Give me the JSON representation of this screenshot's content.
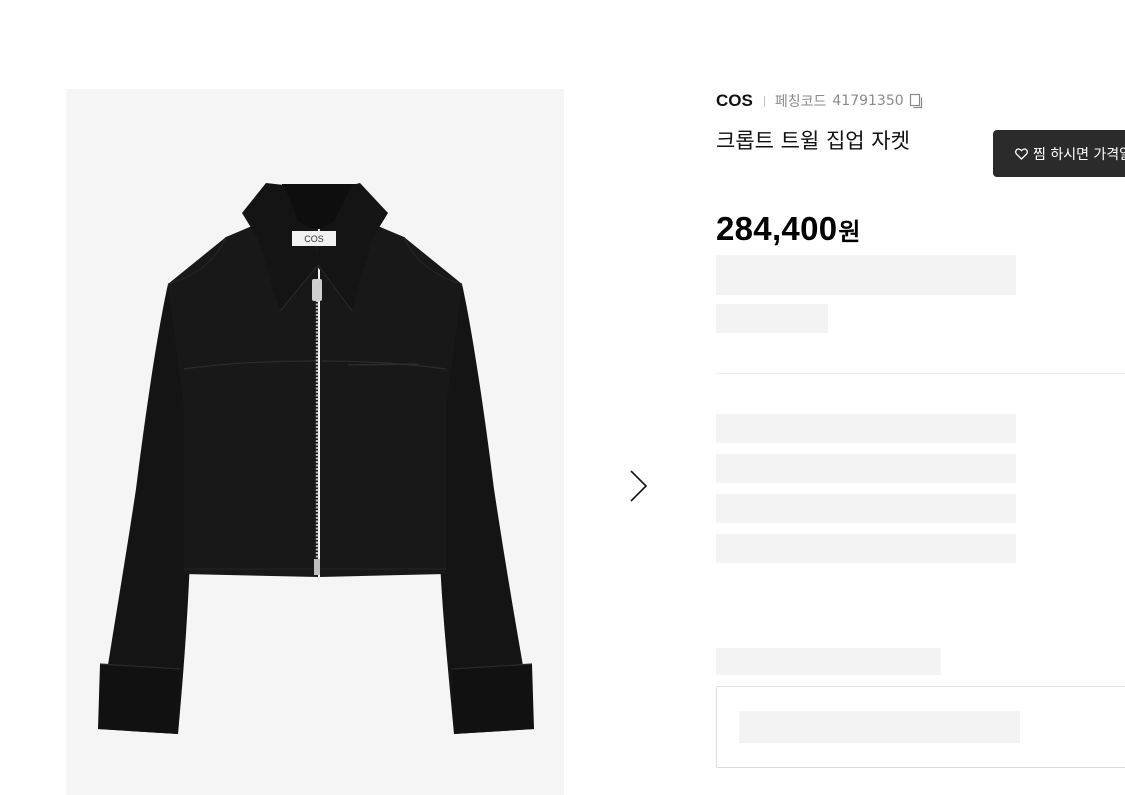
{
  "product": {
    "brand": "COS",
    "code_label": "페칭코드",
    "code_value": "41791350",
    "title": "크롭트 트윌 집업 자켓",
    "price_number": "284,400",
    "price_unit": "원",
    "image_alt": "COS cropped twill zip-up jacket"
  },
  "wishlist": {
    "label": "찜 하시면 가격알림"
  },
  "gallery": {
    "label_text": "COS"
  },
  "icons": {
    "copy": "copy-icon",
    "heart": "heart-icon",
    "next": "chevron-right-icon"
  },
  "colors": {
    "jacket": "#161616",
    "panel_bg": "#f5f5f5",
    "button_bg": "#2b2b2b",
    "skeleton": "#f3f3f3"
  }
}
